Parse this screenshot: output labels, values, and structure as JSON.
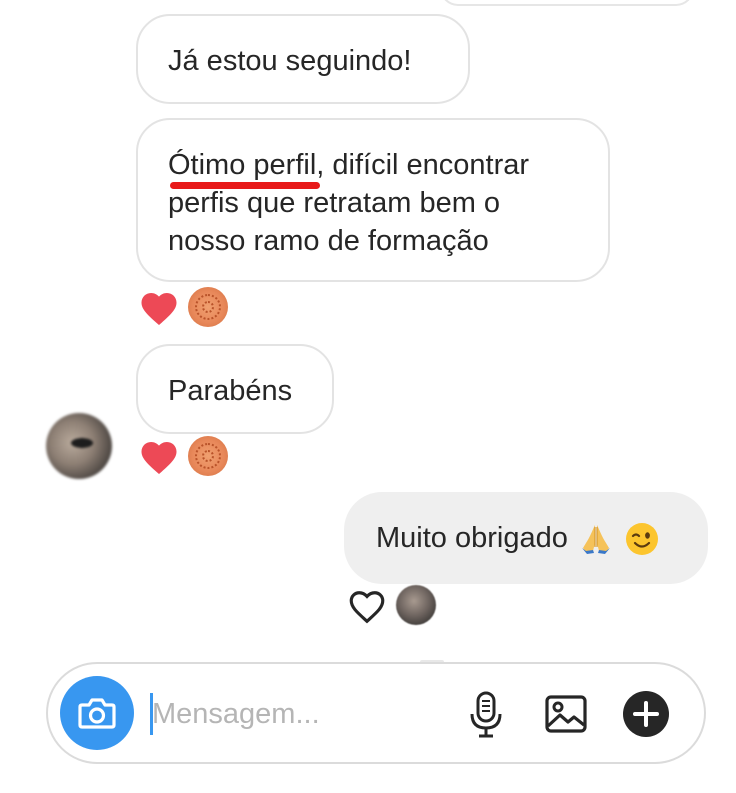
{
  "messages": {
    "m1": "Já estou seguindo!",
    "m2_underlined": "Ótimo perfil",
    "m2_rest": ", difícil encontrar perfis que retratam bem o nosso ramo de formação",
    "m3": "Parabéns",
    "m4": "Muito obrigado"
  },
  "icons": {
    "reaction": "heart-icon",
    "reaction_outline": "heart-outline-icon",
    "emoji_1": "folded-hands-emoji",
    "emoji_2": "winking-face-emoji",
    "camera": "camera-icon",
    "mic": "microphone-icon",
    "gallery": "image-icon",
    "plus": "plus-icon"
  },
  "composer": {
    "placeholder": "Mensagem..."
  },
  "colors": {
    "accent": "#3897f0",
    "heart": "#ed4956",
    "underline": "#e81a1a",
    "outgoing_bubble": "#efefef"
  }
}
